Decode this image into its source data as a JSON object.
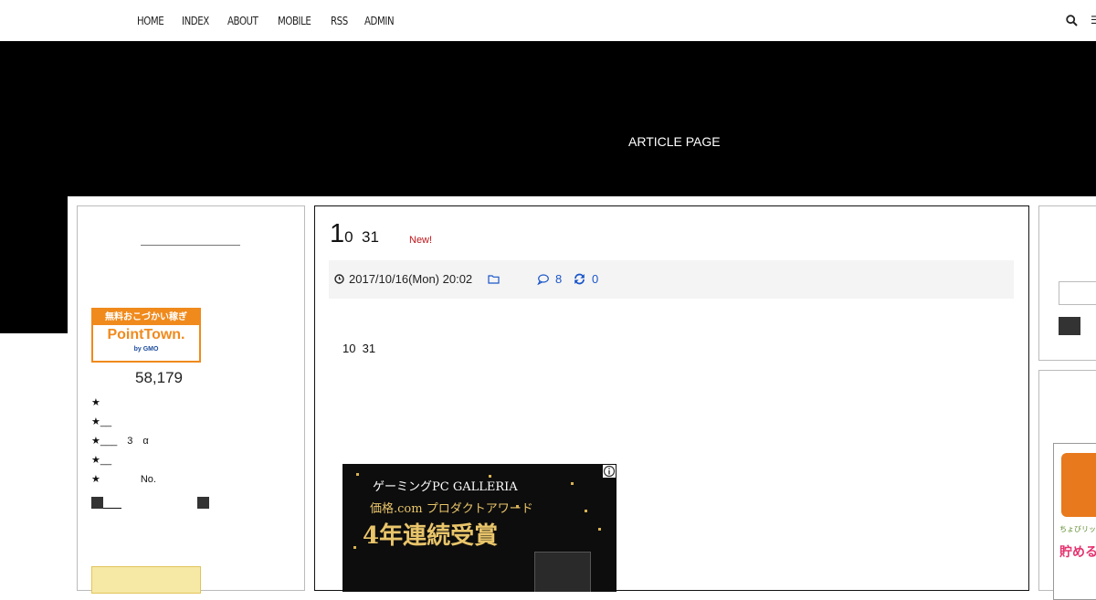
{
  "nav": {
    "items": [
      "HOME",
      "INDEX",
      "ABOUT",
      "MOBILE",
      "RSS",
      "ADMIN"
    ]
  },
  "header": {
    "title": "ARTICLE PAGE"
  },
  "left_sidebar": {
    "pointtown": {
      "top_text": "無料おこづかい稼ぎ",
      "logo_text": "PointTown.",
      "sub_text": "by GMO"
    },
    "counter": "58,179",
    "star_lines": [
      "★",
      "★__",
      "★___　3　α",
      "★__",
      "★　　　　No."
    ]
  },
  "article": {
    "title_big": "1",
    "title_small": "0  31",
    "new_badge": "New!",
    "date": "2017/10/16(Mon) 20:02",
    "comment_count": "8",
    "trackback_count": "0",
    "body_text": "10  31",
    "ad": {
      "line1": "ゲーミングPC GALLERIA",
      "line2": "価格.com プロダクトアワード",
      "line3": "4年連続受賞"
    }
  },
  "right_sidebar": {
    "ad": {
      "line1": "ちょびリッチ",
      "line2": "貯める"
    }
  },
  "colors": {
    "header_bg": "#000000",
    "new_badge": "#c0151a",
    "link_blue": "#1a56c9",
    "pointtown_orange": "#f08a1c"
  },
  "icons": [
    "search-icon",
    "clock-icon",
    "folder-icon",
    "comment-icon",
    "refresh-icon",
    "info-icon"
  ]
}
